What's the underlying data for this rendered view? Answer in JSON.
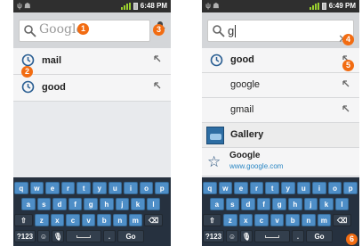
{
  "status": {
    "clock_left": "6:48 PM",
    "clock_right": "6:49 PM",
    "icons_left": "ψ ☗"
  },
  "left": {
    "placeholder": "Google",
    "suggestions": [
      {
        "text": "mail"
      },
      {
        "text": "good"
      }
    ],
    "badges": [
      "1",
      "2",
      "3"
    ]
  },
  "right": {
    "query": "g",
    "suggestions": [
      {
        "text": "good"
      },
      {
        "text": "google"
      },
      {
        "text": "gmail"
      }
    ],
    "app": {
      "label": "Gallery"
    },
    "bookmark": {
      "title": "Google",
      "url": "www.google.com"
    },
    "badges": [
      "4",
      "5",
      "6"
    ]
  },
  "keyboard": {
    "row1": [
      "q",
      "w",
      "e",
      "r",
      "t",
      "y",
      "u",
      "i",
      "o",
      "p"
    ],
    "row2": [
      "a",
      "s",
      "d",
      "f",
      "g",
      "h",
      "j",
      "k",
      "l"
    ],
    "row3": [
      "⇧",
      "z",
      "x",
      "c",
      "v",
      "b",
      "n",
      "m",
      "⌫"
    ],
    "row4": [
      "?123",
      "☺",
      "🎙",
      "␣",
      ".",
      "Go"
    ]
  },
  "colors": {
    "badge": "#f26c12",
    "key": "#4e8ec7",
    "keyboard_bg": "#26313f"
  }
}
